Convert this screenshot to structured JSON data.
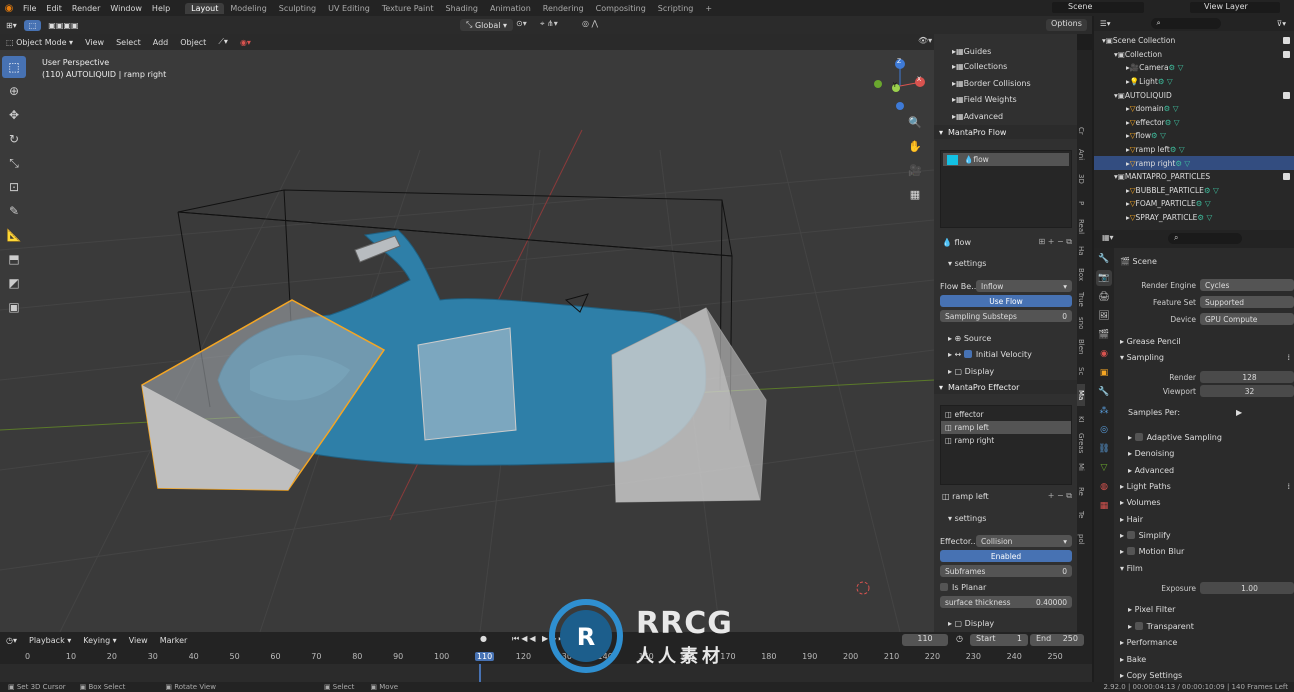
{
  "topbar": {
    "menus": [
      "File",
      "Edit",
      "Render",
      "Window",
      "Help"
    ],
    "workspaces": [
      "Layout",
      "Modeling",
      "Sculpting",
      "UV Editing",
      "Texture Paint",
      "Shading",
      "Animation",
      "Rendering",
      "Compositing",
      "Scripting"
    ],
    "active_workspace": "Layout",
    "scene": "Scene",
    "view_layer": "View Layer"
  },
  "toolheader": {
    "orientation": "Global",
    "options": "Options"
  },
  "viewport_header": {
    "mode": "Object Mode",
    "menus": [
      "View",
      "Select",
      "Add",
      "Object"
    ]
  },
  "viewport": {
    "perspective": "User Perspective",
    "object_info": "(110) AUTOLIQUID | ramp right"
  },
  "gizmo": {
    "x": "X",
    "y": "Y",
    "z": "Z"
  },
  "npanel": {
    "items_top": [
      "Guides",
      "Collections",
      "Border Collisions",
      "Field Weights",
      "Advanced"
    ],
    "flow_header": "MantaPro Flow",
    "flow_list": [
      "flow"
    ],
    "flow_name": "flow",
    "settings": "settings",
    "flow_behavior_label": "Flow Be...",
    "flow_behavior_value": "Inflow",
    "use_flow": "Use Flow",
    "sampling_substeps_label": "Sampling Substeps",
    "sampling_substeps_value": "0",
    "subsections": [
      "Source",
      "Initial Velocity",
      "Display"
    ],
    "effector_header": "MantaPro Effector",
    "effector_list": [
      "effector",
      "ramp left",
      "ramp right"
    ],
    "effector_selected": "ramp left",
    "effector_name": "ramp left",
    "effector_type_label": "Effector...",
    "effector_type_value": "Collision",
    "enabled": "Enabled",
    "subframes_label": "Subframes",
    "subframes_value": "0",
    "is_planar": "Is Planar",
    "surface_thickness_label": "surface thickness",
    "surface_thickness_value": "0.40000",
    "display": "Display",
    "tabs": [
      "Cr",
      "Ani",
      "3D",
      "P",
      "Real",
      "Ha",
      "Box",
      "True",
      "sno",
      "Blen",
      "Sc",
      "Ma",
      "KI",
      "Greas",
      "Mi",
      "Re",
      "Te",
      "pol"
    ]
  },
  "outliner": {
    "rows": [
      {
        "label": "Scene Collection",
        "indent": 0
      },
      {
        "label": "Collection",
        "indent": 1
      },
      {
        "label": "Camera",
        "indent": 2
      },
      {
        "label": "Light",
        "indent": 2
      },
      {
        "label": "AUTOLIQUID",
        "indent": 1
      },
      {
        "label": "domain",
        "indent": 2
      },
      {
        "label": "effector",
        "indent": 2
      },
      {
        "label": "flow",
        "indent": 2
      },
      {
        "label": "ramp left",
        "indent": 2
      },
      {
        "label": "ramp right",
        "indent": 2,
        "selected": true
      },
      {
        "label": "MANTAPRO_PARTICLES",
        "indent": 1
      },
      {
        "label": "BUBBLE_PARTICLE",
        "indent": 2
      },
      {
        "label": "FOAM_PARTICLE",
        "indent": 2
      },
      {
        "label": "SPRAY_PARTICLE",
        "indent": 2
      }
    ]
  },
  "properties": {
    "scene": "Scene",
    "render_engine_label": "Render Engine",
    "render_engine_value": "Cycles",
    "feature_set_label": "Feature Set",
    "feature_set_value": "Supported",
    "device_label": "Device",
    "device_value": "GPU Compute",
    "grease_pencil": "Grease Pencil",
    "sampling": "Sampling",
    "render_label": "Render",
    "render_value": "128",
    "viewport_label": "Viewport",
    "viewport_value": "32",
    "samples_per": "Samples Per:",
    "adaptive_sampling": "Adaptive Sampling",
    "denoising": "Denoising",
    "advanced": "Advanced",
    "light_paths": "Light Paths",
    "volumes": "Volumes",
    "hair": "Hair",
    "simplify": "Simplify",
    "motion_blur": "Motion Blur",
    "film": "Film",
    "exposure_label": "Exposure",
    "exposure_value": "1.00",
    "pixel_filter": "Pixel Filter",
    "transparent": "Transparent",
    "performance": "Performance",
    "bake": "Bake",
    "copy_settings": "Copy Settings"
  },
  "timeline": {
    "menus": [
      "Playback",
      "Keying",
      "View",
      "Marker"
    ],
    "current_frame": "110",
    "start_label": "Start",
    "start_value": "1",
    "end_label": "End",
    "end_value": "250",
    "ticks": [
      "0",
      "10",
      "20",
      "30",
      "40",
      "50",
      "60",
      "70",
      "80",
      "90",
      "100",
      "110",
      "120",
      "130",
      "140",
      "150",
      "160",
      "170",
      "180",
      "190",
      "200",
      "210",
      "220",
      "230",
      "240",
      "250"
    ]
  },
  "statusbar": {
    "items": [
      "Set 3D Cursor",
      "Box Select",
      "Rotate View",
      "Select",
      "Move"
    ],
    "right": "2.92.0 | 00:00:04:13 / 00:00:10:09 | 140 Frames Left"
  },
  "watermark": {
    "brand": "RRCG",
    "subtitle": "人人素材"
  },
  "colors": {
    "accent": "#4772b3",
    "liquid": "#2e7fa8",
    "selection": "#f5a623"
  }
}
